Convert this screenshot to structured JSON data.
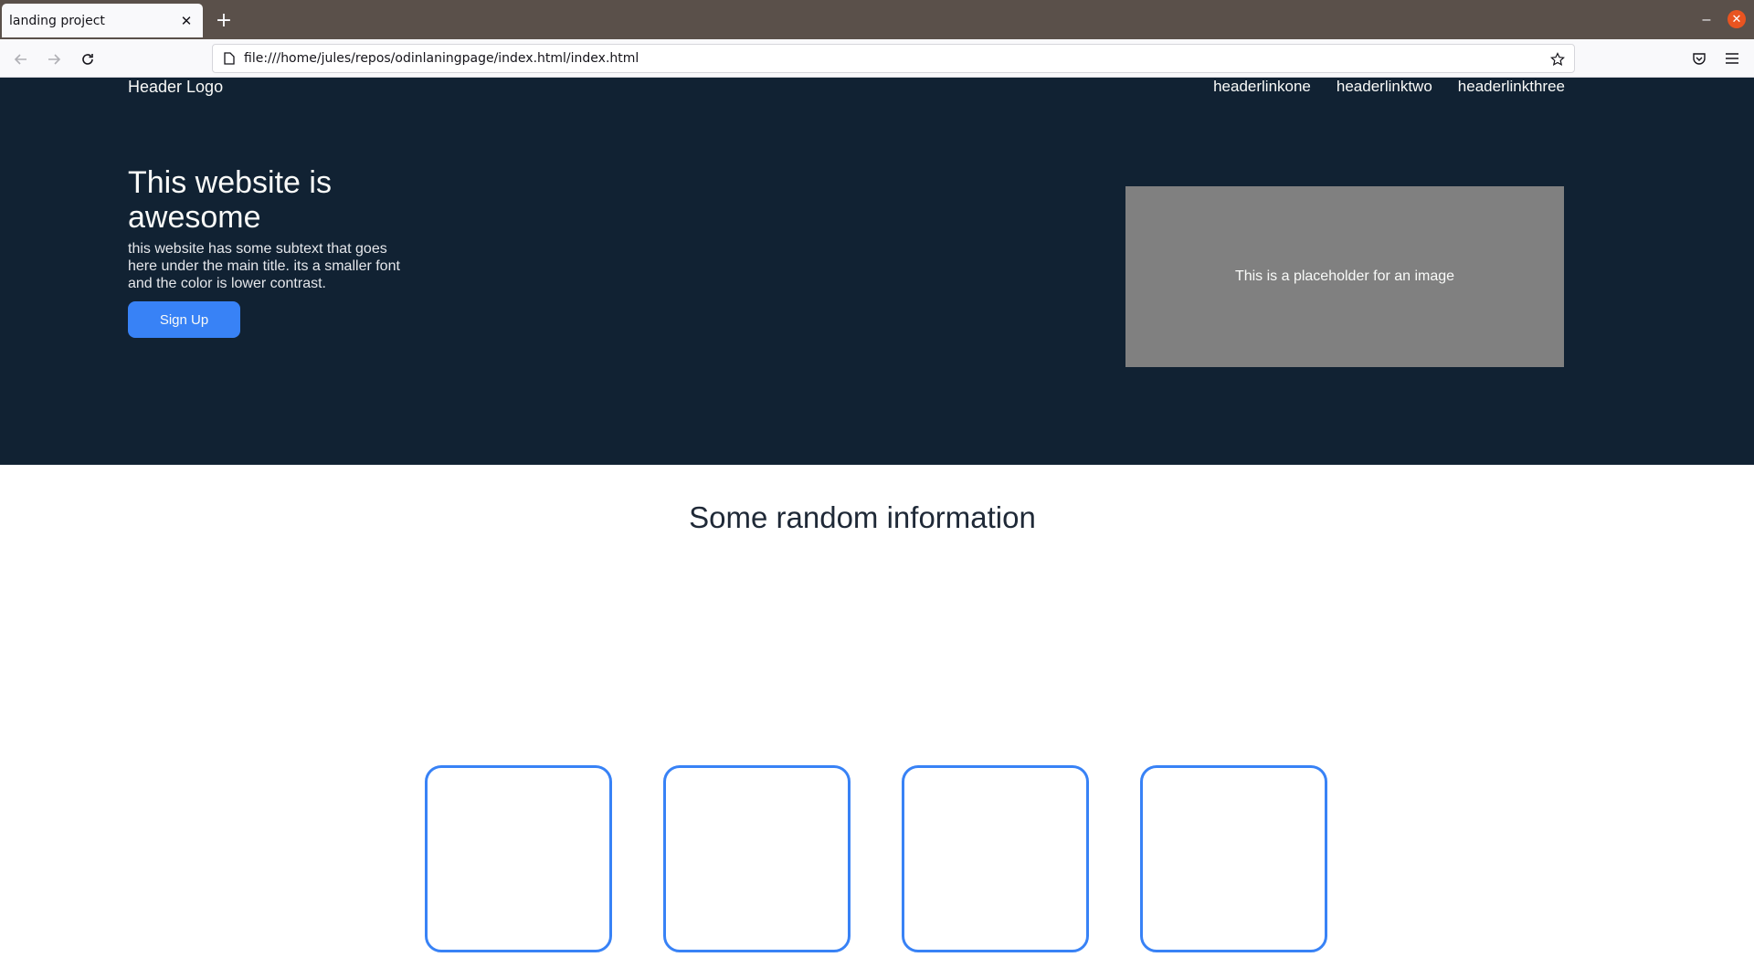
{
  "browser": {
    "tab_title": "landing project",
    "url": "file:///home/jules/repos/odinlaningpage/index.html/index.html"
  },
  "header": {
    "logo": "Header Logo",
    "links": [
      "headerlinkone",
      "headerlinktwo",
      "headerlinkthree"
    ]
  },
  "hero": {
    "title": "This website is awesome",
    "subtext": "this website has some subtext that goes here under the main title. its a smaller font and the color is lower contrast.",
    "signup_label": "Sign Up",
    "image_placeholder": "This is a placeholder for an image"
  },
  "info": {
    "title": "Some random information"
  },
  "colors": {
    "hero_bg": "#112233",
    "accent": "#3882f6",
    "placeholder_bg": "#808080"
  }
}
